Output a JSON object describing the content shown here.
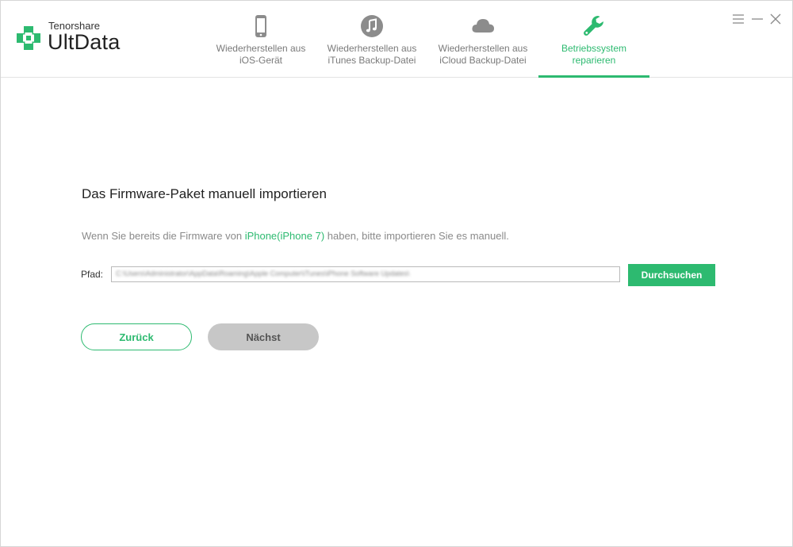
{
  "brand": {
    "small": "Tenorshare",
    "name": "UltData",
    "accent_color": "#2dba70"
  },
  "tabs": [
    {
      "id": "ios",
      "icon": "phone-icon",
      "label_line1": "Wiederherstellen aus",
      "label_line2": "iOS-Gerät",
      "active": false
    },
    {
      "id": "itunes",
      "icon": "music-note-icon",
      "label_line1": "Wiederherstellen aus",
      "label_line2": "iTunes Backup-Datei",
      "active": false
    },
    {
      "id": "icloud",
      "icon": "cloud-icon",
      "label_line1": "Wiederherstellen aus",
      "label_line2": "iCloud Backup-Datei",
      "active": false
    },
    {
      "id": "repair",
      "icon": "wrench-icon",
      "label_line1": "Betriebssystem",
      "label_line2": "reparieren",
      "active": true
    }
  ],
  "window_controls": [
    "menu-icon",
    "minimize-icon",
    "close-icon"
  ],
  "content": {
    "title": "Das Firmware-Paket manuell importieren",
    "desc_before": "Wenn Sie bereits die Firmware von ",
    "desc_highlight": "iPhone(iPhone 7)",
    "desc_after": " haben, bitte importieren Sie es manuell.",
    "path_label": "Pfad:",
    "path_value": "C:\\Users\\Administrator\\AppData\\Roaming\\Apple Computer\\iTunes\\iPhone Software Updates\\",
    "browse_label": "Durchsuchen",
    "back_label": "Zurück",
    "next_label": "Nächst"
  }
}
